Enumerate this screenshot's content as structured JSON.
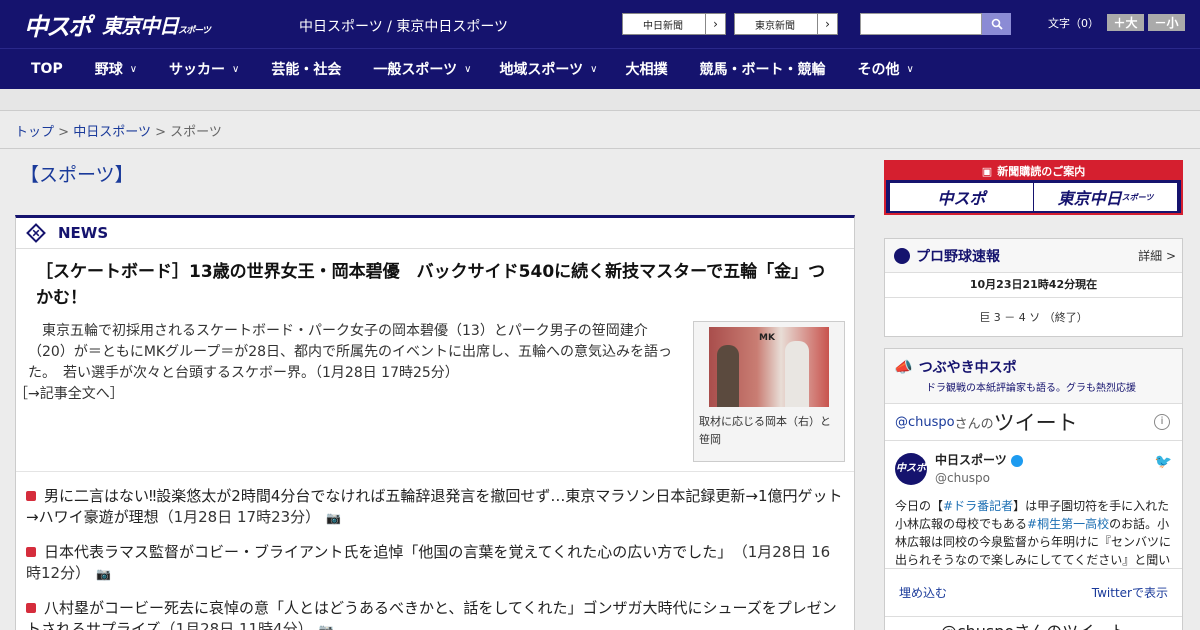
{
  "header": {
    "logo_main": "中スポ",
    "logo_sub": "東京中日",
    "logo_sub_small": "スポーツ",
    "site_name": "中日スポーツ / 東京中日スポーツ",
    "paper_links": [
      {
        "label": "中日新聞"
      },
      {
        "label": "東京新聞"
      }
    ],
    "search_placeholder": "",
    "font_size_label": "文字（0）",
    "font_plus": "＋大",
    "font_minus": "－小"
  },
  "nav": {
    "items": [
      {
        "label": "TOP",
        "has_dropdown": false
      },
      {
        "label": "野球",
        "has_dropdown": true
      },
      {
        "label": "サッカー",
        "has_dropdown": true
      },
      {
        "label": "芸能・社会",
        "has_dropdown": false
      },
      {
        "label": "一般スポーツ",
        "has_dropdown": true
      },
      {
        "label": "地域スポーツ",
        "has_dropdown": true
      },
      {
        "label": "大相撲",
        "has_dropdown": false
      },
      {
        "label": "競馬・ボート・競輪",
        "has_dropdown": false
      },
      {
        "label": "その他",
        "has_dropdown": true
      }
    ]
  },
  "breadcrumb": {
    "home": "トップ",
    "parent": "中日スポーツ",
    "current": "スポーツ",
    "sep": ">"
  },
  "page_title": "【スポーツ】",
  "news": {
    "heading": "NEWS",
    "lead": {
      "title": "［スケートボード］13歳の世界女王・岡本碧優　バックサイド540に続く新技マスターで五輪「金」つかむ！",
      "body": "東京五輪で初採用されるスケートボード・パーク女子の岡本碧優（13）とパーク男子の笹岡建介（20）が＝ともにMKグループ＝が28日、都内で所属先のイベントに出席し、五輪への意気込みを語った。　若い選手が次々と台頭するスケボー界。（1月28日 17時25分）",
      "more": "［→記事全文へ］",
      "photo_caption": "取材に応じる岡本（右）と笹岡",
      "photo_logo": "MK"
    },
    "items": [
      {
        "text": "男に二言はない‼設楽悠太が2時間4分台でなければ五輪辞退発言を撤回せず…東京マラソン日本記録更新→1億円ゲット→ハワイ豪遊が理想",
        "date": "（1月28日 17時23分）"
      },
      {
        "text": "日本代表ラマス監督がコビー・ブライアント氏を追悼「他国の言葉を覚えてくれた心の広い方でした」",
        "date": "（1月28日 16時12分）"
      },
      {
        "text": "八村塁がコービー死去に哀悼の意「人とはどうあるべきかと、話をしてくれた」ゴンザガ大時代にシューズをプレゼントされるサプライズ",
        "date": "（1月28日 11時4分）"
      }
    ]
  },
  "ad": {
    "title": "新聞購読のご案内",
    "left": "中スポ",
    "right": "東京中日",
    "right_small": "スポーツ"
  },
  "baseball": {
    "title": "プロ野球速報",
    "detail": "詳細 >",
    "time": "10月23日21時42分現在",
    "score": "巨 3 － 4 ソ （終了）"
  },
  "tweets": {
    "title": "つぶやき中スポ",
    "subtitle": "ドラ観戦の本紙評論家も語る。グラも熱烈応援",
    "handle": "@chuspo",
    "handle_suffix": "さんの",
    "tweet_word": "ツイート",
    "account_name": "中日スポーツ",
    "account_id": "@chuspo",
    "avatar": "中スポ",
    "body_parts": [
      {
        "t": "今日の【",
        "tag": false
      },
      {
        "t": "#ドラ番記者",
        "tag": true
      },
      {
        "t": "】は甲子園切符を手に入れた小林広報の母校でもある",
        "tag": false
      },
      {
        "t": "#桐生第一高校",
        "tag": true
      },
      {
        "t": "のお話。小林広報は同校の今泉監督から年明けに『センバツに出られそうなので楽しみにしててください』と聞いていた",
        "tag": false
      }
    ],
    "embed": "埋め込む",
    "view_on": "Twitterで表示",
    "footer_more": "@chuspoさんのツイート"
  }
}
